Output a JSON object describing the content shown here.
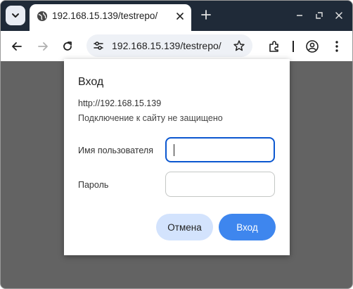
{
  "browser": {
    "tab": {
      "title": "192.168.15.139/testrepo/"
    },
    "omnibox": {
      "url": "192.168.15.139/testrepo/"
    },
    "icons": {
      "tab_search": "chevron-down-icon",
      "favicon": "globe-icon",
      "tab_close": "close-icon",
      "new_tab": "plus-icon",
      "back": "arrow-left-icon",
      "forward": "arrow-right-icon",
      "reload": "reload-icon",
      "site_info": "tune-icon",
      "bookmark": "star-icon",
      "extensions": "puzzle-icon",
      "profile": "profile-icon",
      "menu": "kebab-icon"
    }
  },
  "dialog": {
    "title": "Вход",
    "origin": "http://192.168.15.139",
    "warning": "Подключение к сайту не защищено",
    "username_label": "Имя пользователя",
    "username_value": "",
    "password_label": "Пароль",
    "password_value": "",
    "cancel_label": "Отмена",
    "login_label": "Вход"
  },
  "colors": {
    "tabstrip_bg": "#1f2a38",
    "page_dim_bg": "#636363",
    "focus_ring": "#0b57d0",
    "primary_button": "#3e86ee",
    "tonal_button": "#d3e3fd"
  }
}
